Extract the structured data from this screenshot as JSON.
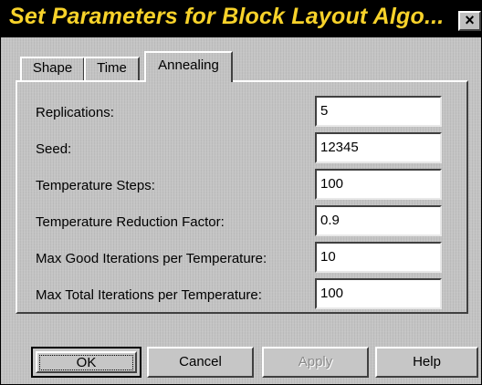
{
  "window": {
    "title": "Set Parameters for Block Layout Algo...",
    "close_glyph": "×"
  },
  "tabs": [
    {
      "label": "Shape"
    },
    {
      "label": "Time"
    },
    {
      "label": "Annealing",
      "selected": true
    }
  ],
  "fields": [
    {
      "label": "Replications:",
      "value": "5"
    },
    {
      "label": "Seed:",
      "value": "12345"
    },
    {
      "label": "Temperature Steps:",
      "value": "100"
    },
    {
      "label": "Temperature Reduction Factor:",
      "value": "0.9"
    },
    {
      "label": "Max Good Iterations per Temperature:",
      "value": "10"
    },
    {
      "label": "Max Total Iterations per Temperature:",
      "value": "100"
    }
  ],
  "buttons": {
    "ok": "OK",
    "cancel": "Cancel",
    "apply": "Apply",
    "help": "Help"
  },
  "colors": {
    "title_text": "#f7d22a",
    "title_bar": "#000000",
    "face": "#c6c6c6"
  }
}
